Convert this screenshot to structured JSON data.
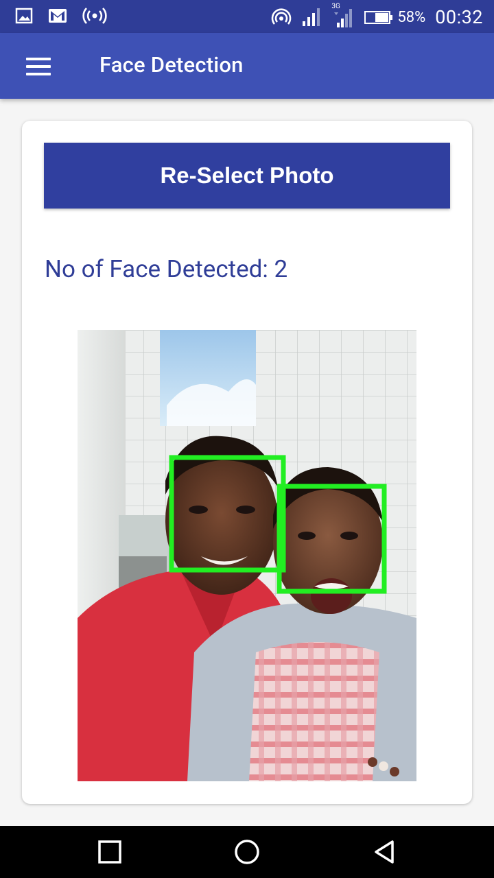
{
  "status_bar": {
    "battery_percent": "58%",
    "time": "00:32",
    "network_label": "3G",
    "icons": [
      "image-icon",
      "gmail-icon",
      "hotspot-icon",
      "wifi-icon",
      "signal-icon",
      "signal-3g-icon",
      "battery-icon"
    ]
  },
  "app_bar": {
    "title": "Face Detection",
    "menu_icon": "hamburger-menu-icon"
  },
  "main": {
    "reselect_button_label": "Re-Select Photo",
    "face_count_text": "No of Face Detected: 2",
    "photo": {
      "detected_faces": 2,
      "box_color": "#22ee22"
    }
  },
  "nav_bar": {
    "icons": [
      "recents-square-icon",
      "home-circle-icon",
      "back-triangle-icon"
    ]
  },
  "colors": {
    "status_bar": "#2f3d97",
    "app_bar": "#3e51b5",
    "button": "#303f9f",
    "text_accent": "#2f3d97"
  }
}
